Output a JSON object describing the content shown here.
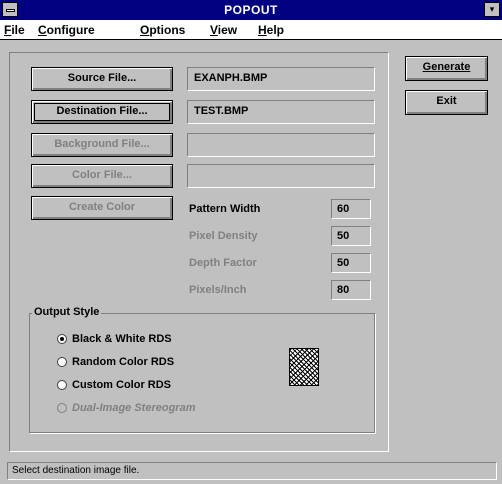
{
  "window": {
    "title": "POPOUT",
    "maximize_glyph": "▾",
    "system_menu_icon": "system-menu-icon"
  },
  "menu": {
    "items": [
      {
        "hot": "F",
        "rest": "ile"
      },
      {
        "hot": "C",
        "rest": "onfigure"
      },
      {
        "hot": "O",
        "rest": "ptions"
      },
      {
        "hot": "V",
        "rest": "iew"
      },
      {
        "hot": "H",
        "rest": "elp"
      }
    ]
  },
  "files": {
    "source_button": "Source File...",
    "source_value": "EXANPH.BMP",
    "destination_button": "Destination File...",
    "destination_value": "TEST.BMP",
    "background_button": "Background File...",
    "background_value": "",
    "color_button": "Color File...",
    "color_value": "",
    "create_color_button": "Create Color"
  },
  "params": {
    "pattern_width_label": "Pattern Width",
    "pattern_width_value": "60",
    "pixel_density_label": "Pixel Density",
    "pixel_density_value": "50",
    "depth_factor_label": "Depth Factor",
    "depth_factor_value": "50",
    "pixels_inch_label": "Pixels/Inch",
    "pixels_inch_value": "80"
  },
  "output_style": {
    "title": "Output Style",
    "options": [
      {
        "label": "Black & White RDS",
        "selected": true,
        "enabled": true
      },
      {
        "label": "Random Color RDS",
        "selected": false,
        "enabled": true
      },
      {
        "label": "Custom Color RDS",
        "selected": false,
        "enabled": true
      },
      {
        "label": "Dual-Image Stereogram",
        "selected": false,
        "enabled": false
      }
    ]
  },
  "actions": {
    "generate": "Generate",
    "exit": "Exit"
  },
  "status": {
    "text": "Select destination image file."
  }
}
